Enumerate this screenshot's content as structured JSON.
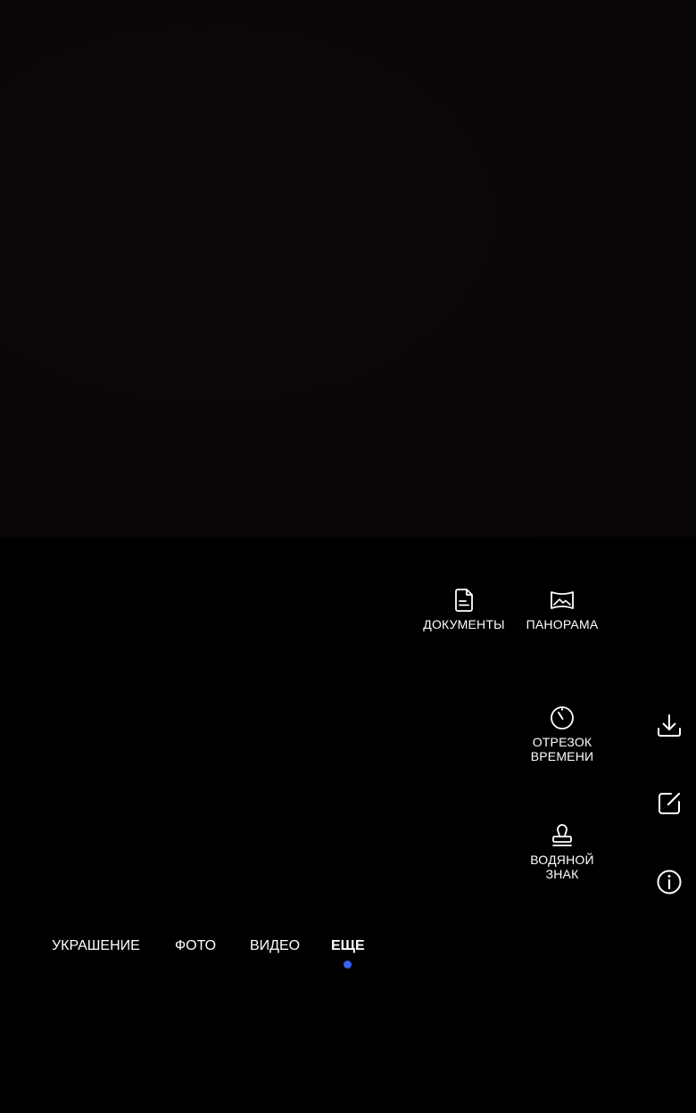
{
  "modes": {
    "documents": {
      "label": "ДОКУМЕНТЫ",
      "icon": "document-icon"
    },
    "panorama": {
      "label": "ПАНОРАМА",
      "icon": "panorama-icon"
    },
    "timelapse": {
      "label": "ОТРЕЗОК\nВРЕМЕНИ",
      "icon": "timer-icon"
    },
    "watermark": {
      "label": "ВОДЯНОЙ\nЗНАК",
      "icon": "stamp-icon"
    }
  },
  "side_actions": {
    "download": {
      "icon": "download-icon"
    },
    "edit": {
      "icon": "edit-icon"
    },
    "info": {
      "icon": "info-icon"
    }
  },
  "tabs": [
    {
      "label": "УКРАШЕНИЕ",
      "active": false
    },
    {
      "label": "ФОТО",
      "active": false
    },
    {
      "label": "ВИДЕО",
      "active": false
    },
    {
      "label": "ЕЩЕ",
      "active": true
    }
  ],
  "colors": {
    "background": "#000000",
    "viewfinder": "#0a0509",
    "accent": "#3a62f0",
    "text": "#ffffff"
  }
}
